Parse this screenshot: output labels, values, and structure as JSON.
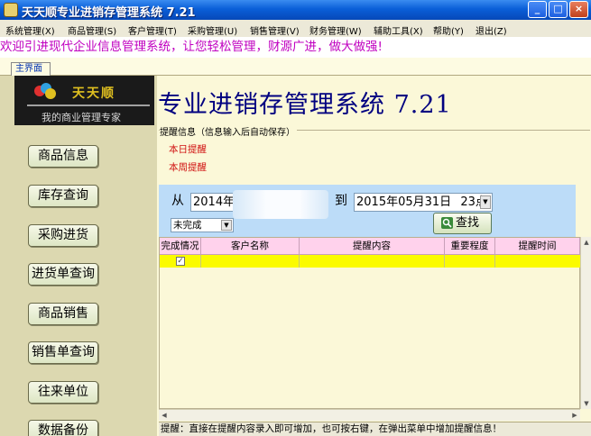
{
  "window": {
    "title": "天天顺专业进销存管理系统 7.21",
    "buttons": {
      "minimize": "_",
      "maximize": "□",
      "close": "×"
    }
  },
  "menu": [
    "系统管理(X)",
    "商品管理(S)",
    "客户管理(T)",
    "采购管理(U)",
    "销售管理(V)",
    "财务管理(W)",
    "辅助工具(X)",
    "帮助(Y)",
    "退出(Z)"
  ],
  "marquee_text": "欢迎引进现代企业信息管理系统，让您轻松管理，财源广进，做大做强!",
  "tab": {
    "label": "主界面"
  },
  "logo": {
    "title": "天天顺",
    "slogan": "我的商业管理专家"
  },
  "sidebar": {
    "items": [
      "商品信息",
      "库存查询",
      "采购进货",
      "进货单查询",
      "商品销售",
      "销售单查询",
      "往来单位",
      "数据备份"
    ]
  },
  "header": {
    "title": "专业进销存管理系统 7.21"
  },
  "reminder": {
    "legend": "提醒信息（信息输入后自动保存）",
    "today": "本日提醒",
    "week": "本周提醒"
  },
  "filter": {
    "from_label": "从",
    "to_label": "到",
    "from_value": "2014年",
    "to_value": "2015年05月31日",
    "to_hour": "23点",
    "status_value": "未完成",
    "search_label": "查找"
  },
  "grid": {
    "columns": [
      "完成情况",
      "客户名称",
      "提醒内容",
      "重要程度",
      "提醒时间"
    ],
    "rows": [
      {
        "done": "✓",
        "customer": "",
        "content": "",
        "importance": "",
        "time": ""
      }
    ]
  },
  "statusbar": {
    "text": "提醒：直接在提醒内容录入即可增加，也可按右键，在弹出菜单中增加提醒信息！"
  },
  "colors": {
    "title_blue": "#0a5fd8",
    "marquee_magenta": "#c000c0",
    "reminder_red": "#d01010",
    "row_yellow": "#fbfb00",
    "header_pink": "#ffd2ec",
    "filter_blue": "#bcdcf8"
  },
  "icons": {
    "app": "app-icon",
    "search": "search-icon",
    "check": "check-icon"
  }
}
